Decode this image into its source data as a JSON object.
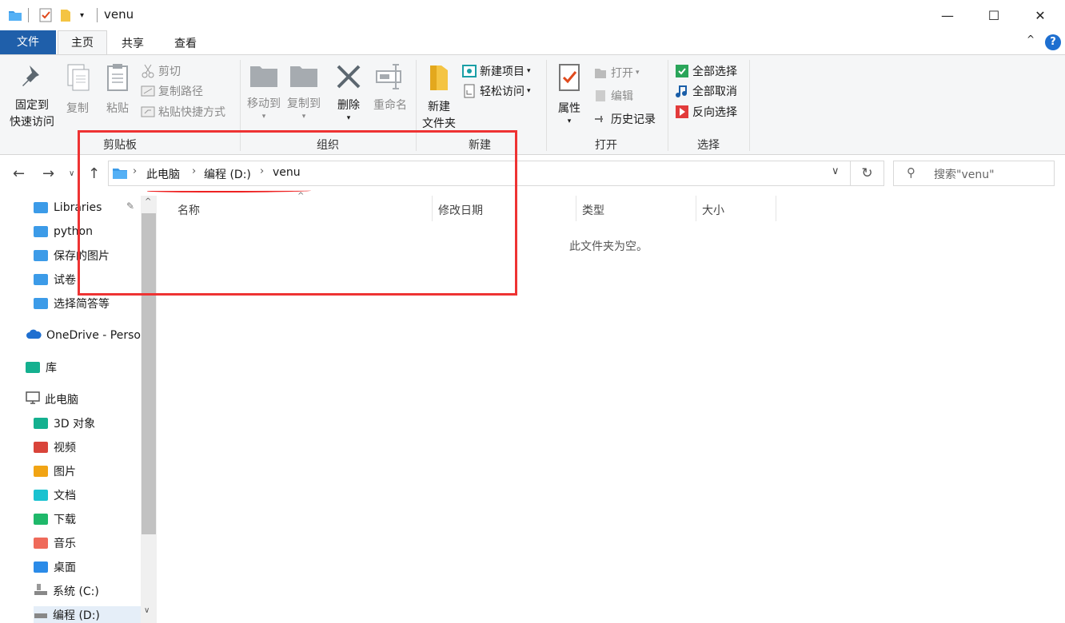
{
  "window": {
    "title": "venu",
    "minimize": "—",
    "maximize": "☐",
    "close": "✕"
  },
  "tabs": {
    "file": "文件",
    "home": "主页",
    "share": "共享",
    "view": "查看",
    "help": "?"
  },
  "ribbon": {
    "clipboard": {
      "label": "剪贴板",
      "pin_line1": "固定到",
      "pin_line2": "快速访问",
      "copy": "复制",
      "paste": "粘贴",
      "cut": "剪切",
      "copy_path": "复制路径",
      "paste_shortcut": "粘贴快捷方式"
    },
    "organize": {
      "label": "组织",
      "move_to": "移动到",
      "copy_to": "复制到",
      "delete": "删除",
      "rename": "重命名"
    },
    "new": {
      "label": "新建",
      "new_folder_line1": "新建",
      "new_folder_line2": "文件夹",
      "new_item": "新建项目",
      "easy_access": "轻松访问"
    },
    "open": {
      "label": "打开",
      "properties": "属性",
      "open": "打开",
      "edit": "编辑",
      "history": "历史记录"
    },
    "select": {
      "label": "选择",
      "select_all": "全部选择",
      "select_none": "全部取消",
      "invert": "反向选择"
    }
  },
  "address": {
    "crumbs": [
      "此电脑",
      "编程 (D:)",
      "venu"
    ],
    "search_placeholder": "搜索\"venu\""
  },
  "navpane": {
    "items": [
      "Libraries",
      "python",
      "保存的图片",
      "试卷",
      "选择简答等",
      "OneDrive - Perso",
      "库",
      "此电脑",
      "3D 对象",
      "视频",
      "图片",
      "文档",
      "下载",
      "音乐",
      "桌面",
      "系统 (C:)",
      "编程 (D:)"
    ]
  },
  "columns": {
    "name": "名称",
    "modified": "修改日期",
    "type": "类型",
    "size": "大小"
  },
  "empty_message": "此文件夹为空。",
  "colors": {
    "file_tab": "#1f5faa",
    "accent": "#1e6fd0",
    "annotation": "#ee3333"
  }
}
